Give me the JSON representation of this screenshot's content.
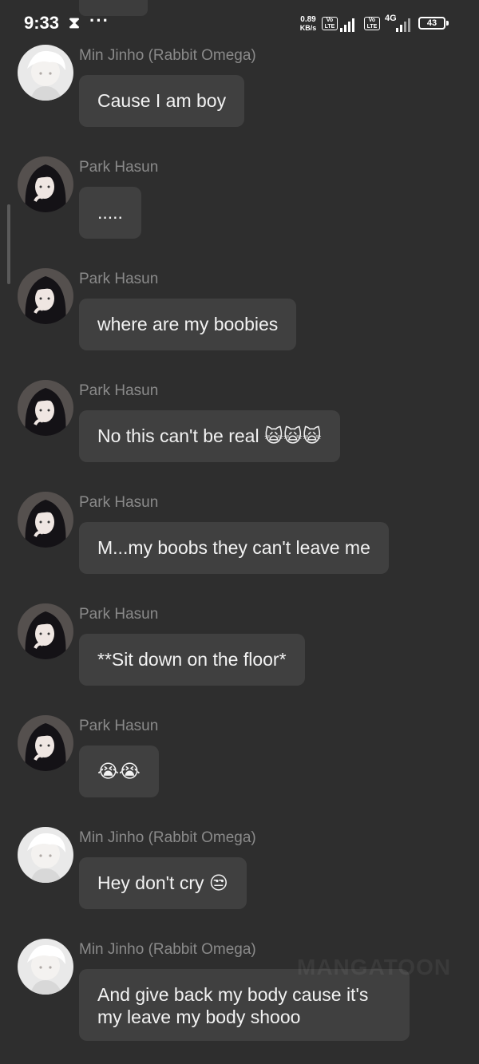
{
  "status_bar": {
    "time": "9:33",
    "hourglass_icon": "⧗",
    "more_indicator": "···",
    "net_speed_value": "0.89",
    "net_speed_unit": "KB/s",
    "lte1": "Vo LTE",
    "lte2": "Vo LTE",
    "network_type": "4G",
    "battery_level": "43"
  },
  "messages": [
    {
      "sender": "Min Jinho (Rabbit Omega)",
      "text": "Cause I am boy",
      "avatar": "white-hair-boy-avatar"
    },
    {
      "sender": "Park Hasun",
      "text": ".....",
      "avatar": "dark-hair-girl-avatar"
    },
    {
      "sender": "Park Hasun",
      "text": "where are my boobies",
      "avatar": "dark-hair-girl-avatar"
    },
    {
      "sender": "Park Hasun",
      "text": "No this can't be real 🙀🙀🙀",
      "avatar": "dark-hair-girl-avatar"
    },
    {
      "sender": "Park Hasun",
      "text": "M...my boobs they can't leave me",
      "avatar": "dark-hair-girl-avatar"
    },
    {
      "sender": "Park Hasun",
      "text": "**Sit down on the floor*",
      "avatar": "dark-hair-girl-avatar"
    },
    {
      "sender": "Park Hasun",
      "text": "😭😭",
      "avatar": "dark-hair-girl-avatar"
    },
    {
      "sender": "Min Jinho (Rabbit Omega)",
      "text": "Hey don't cry 😒",
      "avatar": "white-hair-boy-avatar"
    },
    {
      "sender": "Min Jinho (Rabbit Omega)",
      "text": "And give back my body cause it's my leave my body shooo",
      "avatar": "white-hair-boy-avatar"
    }
  ],
  "watermark": "MANGATOON",
  "colors": {
    "background": "#2e2e2e",
    "bubble": "#404040",
    "sender_name": "#8a8a8a",
    "message_text": "#f2f2f2"
  }
}
